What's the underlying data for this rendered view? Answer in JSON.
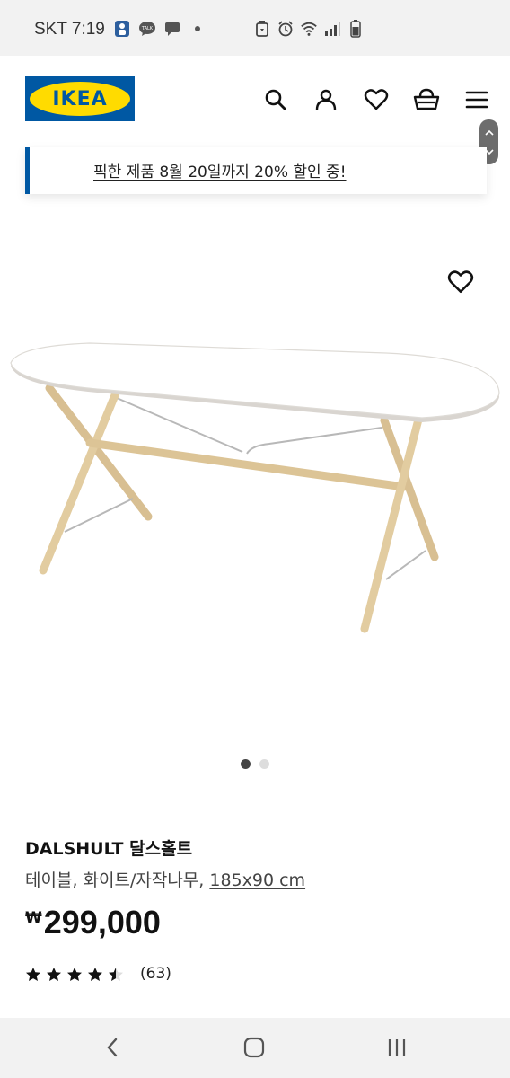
{
  "status_bar": {
    "time": "SKT 7:19",
    "left_icons": [
      "person-app-icon",
      "kakaotalk-icon",
      "message-icon",
      "dot-icon"
    ],
    "right_icons": [
      "recycle-icon",
      "alarm-icon",
      "wifi-icon",
      "signal-icon",
      "battery-icon"
    ]
  },
  "header": {
    "logo_text": "IKEA",
    "icons": [
      "search-icon",
      "user-icon",
      "heart-icon",
      "basket-icon",
      "menu-icon"
    ]
  },
  "promo": {
    "text": "픽한 제품 8월 20일까지 20% 할인 중!"
  },
  "gallery": {
    "total": 2,
    "active_index": 0
  },
  "product": {
    "name": "DALSHULT 달스홀트",
    "desc_main": "테이블, 화이트/자작나무, ",
    "desc_dim": "185x90 cm",
    "currency": "₩",
    "price": "299,000",
    "rating": 4.5,
    "rating_count": "(63)"
  },
  "colors": {
    "brand_blue": "#0058a3",
    "brand_yellow": "#ffdb00"
  }
}
